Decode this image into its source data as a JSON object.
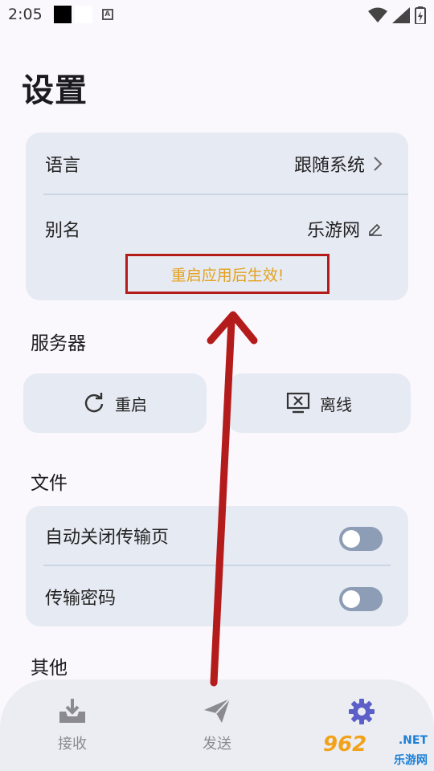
{
  "status_bar": {
    "time": "2:05"
  },
  "page_title": "设置",
  "general_card": {
    "language_label": "语言",
    "language_value": "跟随系统",
    "alias_label": "别名",
    "alias_value": "乐游网",
    "notice": "重启应用后生效!"
  },
  "server": {
    "title": "服务器",
    "restart_label": "重启",
    "offline_label": "离线"
  },
  "files": {
    "title": "文件",
    "auto_close_label": "自动关闭传输页",
    "auto_close_on": false,
    "password_label": "传输密码",
    "password_on": false
  },
  "other": {
    "title": "其他"
  },
  "bottom_nav": {
    "receive_label": "接收",
    "send_label": "发送",
    "settings_selected": true
  },
  "colors": {
    "accent": "#5d5fc9",
    "card": "#e6eaf3",
    "notice": "#e4a11b",
    "annotation": "#b41c1c"
  },
  "watermark": {
    "main": "962",
    "net": ".NET",
    "sub": "乐游网"
  }
}
